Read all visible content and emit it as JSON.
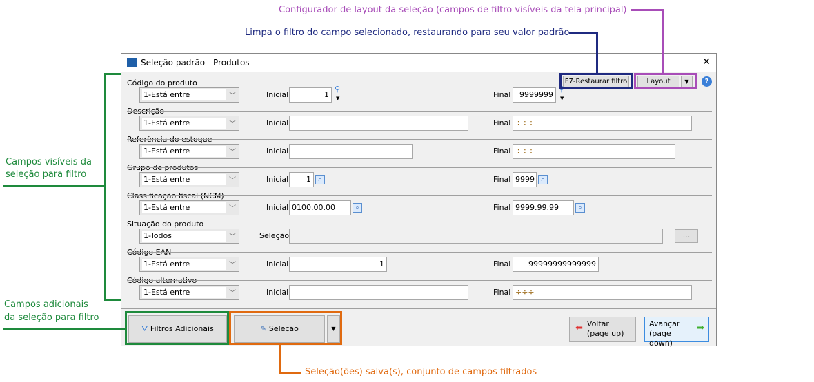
{
  "window": {
    "title": "Seleção padrão - Produtos",
    "close": "✕"
  },
  "toolbar": {
    "restore": "F7-Restaurar filtro",
    "layout": "Layout",
    "dropdown": "▼",
    "help": "?"
  },
  "labels": {
    "inicial": "Inicial",
    "final": "Final",
    "selecao": "Seleção"
  },
  "fields": [
    {
      "label": "Código do produto",
      "op": "1-Está entre",
      "initial": "1",
      "final": "9999999"
    },
    {
      "label": "Descrição",
      "op": "1-Está entre",
      "initial": "",
      "final": "÷÷÷"
    },
    {
      "label": "Referência do estoque",
      "op": "1-Está entre",
      "initial": "",
      "final": "÷÷÷"
    },
    {
      "label": "Grupo de produtos",
      "op": "1-Está entre",
      "initial": "1",
      "final": "9999"
    },
    {
      "label": "Classificação fiscal (NCM)",
      "op": "1-Está entre",
      "initial": "0100.00.00",
      "final": "9999.99.99"
    },
    {
      "label": "Situação do produto",
      "op": "1-Todos",
      "selection": "",
      "browse": "..."
    },
    {
      "label": "Código EAN",
      "op": "1-Está entre",
      "initial": "1",
      "final": "99999999999999"
    },
    {
      "label": "Código alternativo",
      "op": "1-Está entre",
      "initial": "",
      "final": "÷÷÷"
    }
  ],
  "footer": {
    "filtros": "Filtros Adicionais",
    "selecao": "Seleção",
    "dropdown": "▼",
    "voltar1": "Voltar",
    "voltar2": "(page up)",
    "avancar1": "Avançar",
    "avancar2": "(page down)"
  },
  "annotations": {
    "layout": "Configurador de layout da seleção (campos de filtro visíveis da tela principal)",
    "restore": "Limpa o filtro do campo selecionado, restaurando para seu valor padrão",
    "visible1": "Campos visíveis da",
    "visible2": "seleção para filtro",
    "extra1": "Campos adicionais",
    "extra2": "da seleção para filtro",
    "saved": "Seleção(ões) salva(s), conjunto de campos filtrados"
  },
  "colors": {
    "green": "#1e8a3c",
    "orange": "#e06a10",
    "navy": "#1f2a80",
    "purple": "#a84db8"
  }
}
